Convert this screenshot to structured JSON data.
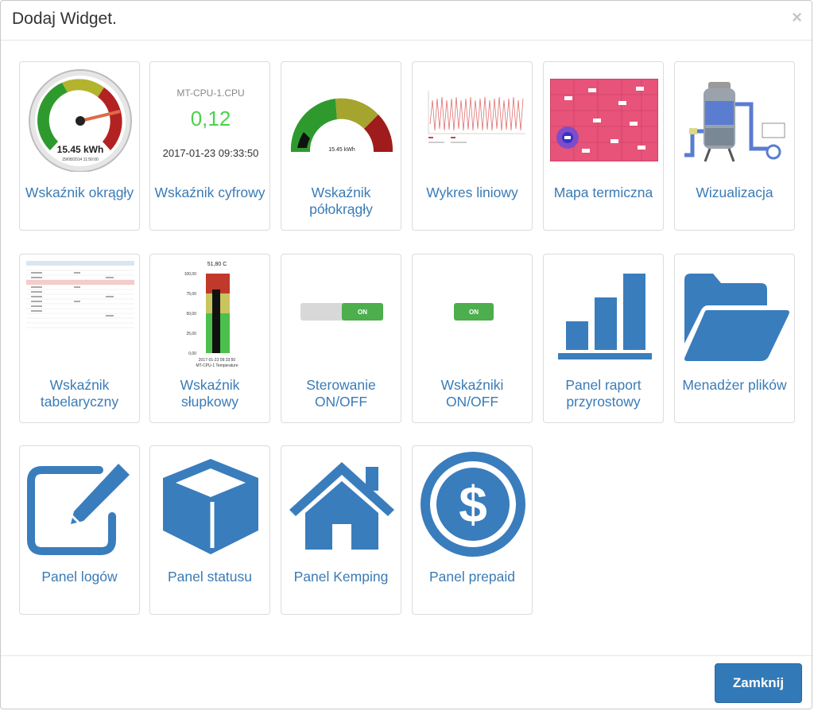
{
  "dialog": {
    "title": "Dodaj Widget.",
    "close_symbol": "×",
    "footer_button": "Zamknij"
  },
  "widgets": [
    {
      "id": "gauge-round",
      "label": "Wskaźnik okrągły",
      "icon": "round-gauge-thumbnail",
      "thumb_text": [
        "15.45 kWh",
        "29/08/2014 11:50:00"
      ]
    },
    {
      "id": "digital",
      "label": "Wskaźnik cyfrowy",
      "icon": "digital-indicator-thumbnail",
      "thumb_text": [
        "MT-CPU-1.CPU",
        "0,12",
        "2017-01-23 09:33:50"
      ]
    },
    {
      "id": "gauge-half",
      "label": "Wskaźnik półokrągły",
      "icon": "half-gauge-thumbnail",
      "thumb_text": [
        "15.45 kWh"
      ]
    },
    {
      "id": "line-chart",
      "label": "Wykres liniowy",
      "icon": "line-chart-thumbnail"
    },
    {
      "id": "heatmap",
      "label": "Mapa termiczna",
      "icon": "heatmap-thumbnail"
    },
    {
      "id": "visualization",
      "label": "Wizualizacja",
      "icon": "visualization-thumbnail"
    },
    {
      "id": "table",
      "label": "Wskaźnik tabelaryczny",
      "icon": "table-thumbnail"
    },
    {
      "id": "bar",
      "label": "Wskaźnik słupkowy",
      "icon": "bar-indicator-thumbnail",
      "thumb_text": [
        "51,80 C",
        "100,00",
        "75,00",
        "50,00",
        "25,00",
        "0,00",
        "2017-01-23 09:33:50",
        "MT-CPU-1 Temperature"
      ]
    },
    {
      "id": "onoff-control",
      "label": "Sterowanie ON/OFF",
      "icon": "toggle-switch-thumbnail",
      "thumb_text": [
        "ON"
      ]
    },
    {
      "id": "onoff-indicators",
      "label": "Wskaźniki ON/OFF",
      "icon": "on-indicator-thumbnail",
      "thumb_text": [
        "ON"
      ]
    },
    {
      "id": "report",
      "label": "Panel raport przyrostowy",
      "icon": "bar-chart-icon"
    },
    {
      "id": "files",
      "label": "Menadżer plików",
      "icon": "folder-open-icon"
    },
    {
      "id": "logs",
      "label": "Panel logów",
      "icon": "edit-pencil-icon"
    },
    {
      "id": "status",
      "label": "Panel statusu",
      "icon": "cube-icon"
    },
    {
      "id": "camping",
      "label": "Panel Kemping",
      "icon": "home-icon"
    },
    {
      "id": "prepaid",
      "label": "Panel prepaid",
      "icon": "dollar-circle-icon"
    }
  ],
  "colors": {
    "accent": "#3279b7",
    "link": "#3a7bb7",
    "icon_blue": "#3a7dbd",
    "digit_green": "#4cd24c"
  }
}
